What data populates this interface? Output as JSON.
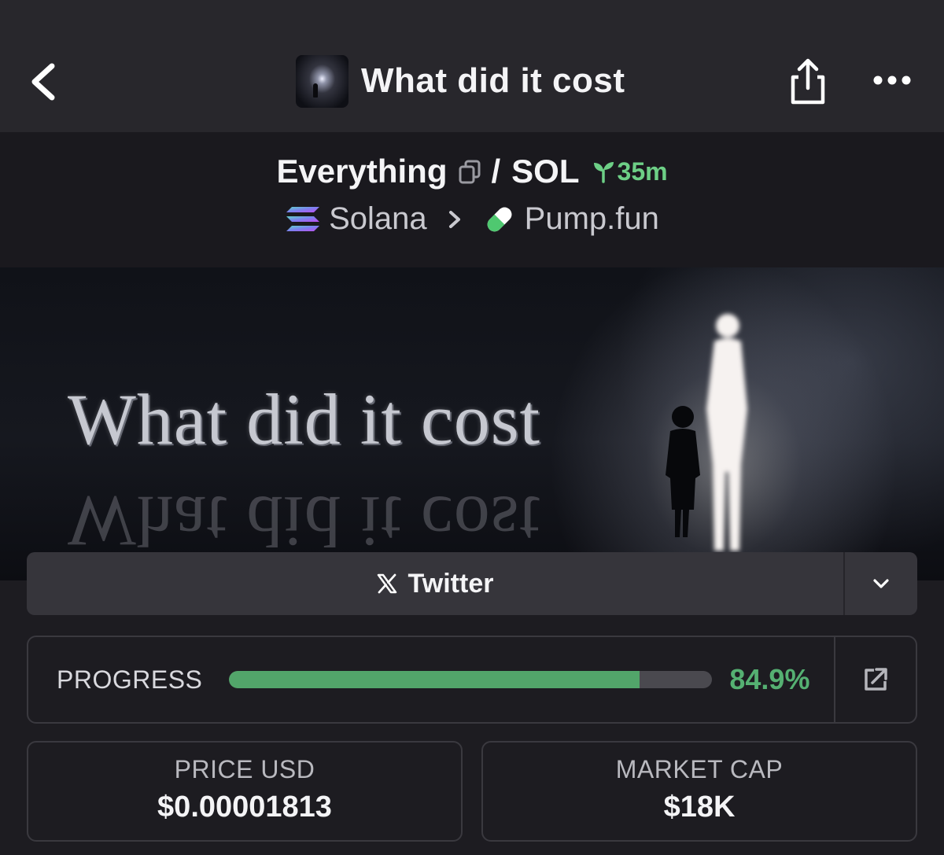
{
  "header": {
    "title": "What did it cost",
    "back_icon": "chevron-left-icon",
    "share_icon": "share-icon",
    "more_icon": "more-horizontal-icon"
  },
  "pair": {
    "base": "Everything",
    "separator": "/",
    "quote": "SOL",
    "age": "35m",
    "chain": "Solana",
    "dex": "Pump.fun"
  },
  "banner": {
    "text": "What did it cost",
    "reflection_text": "What did it cost"
  },
  "social": {
    "twitter_label": "Twitter"
  },
  "progress": {
    "label": "PROGRESS",
    "value_text": "84.9%",
    "fraction": 0.849
  },
  "stats": {
    "price_label": "PRICE USD",
    "price_value": "$0.00001813",
    "mcap_label": "MARKET CAP",
    "mcap_value": "$18K"
  },
  "colors": {
    "accent_green": "#55b072",
    "background": "#1d1c21"
  }
}
